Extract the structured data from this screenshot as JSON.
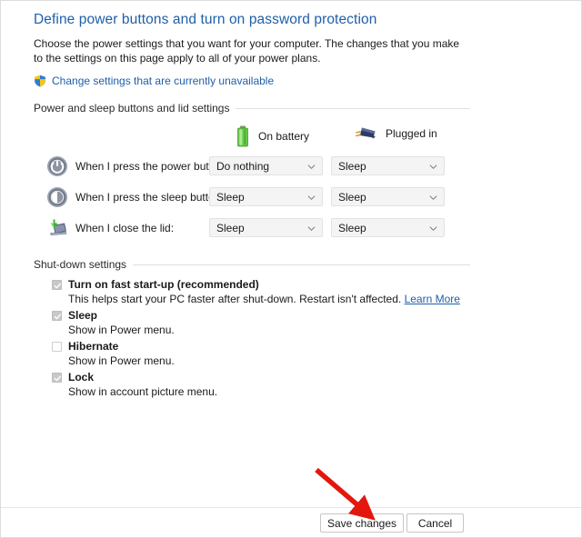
{
  "page": {
    "title": "Define power buttons and turn on password protection",
    "intro": "Choose the power settings that you want for your computer. The changes that you make to the settings on this page apply to all of your power plans.",
    "admin_link": "Change settings that are currently unavailable",
    "admin_link_icon": "uac-shield-icon"
  },
  "sections": {
    "power_buttons": {
      "heading": "Power and sleep buttons and lid settings",
      "columns": [
        {
          "label": "On battery",
          "icon": "battery-icon"
        },
        {
          "label": "Plugged in",
          "icon": "power-plug-icon"
        }
      ],
      "rows": [
        {
          "icon": "power-button-icon",
          "label": "When I press the power button:",
          "on_battery": "Do nothing",
          "plugged_in": "Sleep"
        },
        {
          "icon": "sleep-button-icon",
          "label": "When I press the sleep button:",
          "on_battery": "Sleep",
          "plugged_in": "Sleep"
        },
        {
          "icon": "laptop-lid-icon",
          "label": "When I close the lid:",
          "on_battery": "Sleep",
          "plugged_in": "Sleep"
        }
      ]
    },
    "shutdown": {
      "heading": "Shut-down settings",
      "options": [
        {
          "label": "Turn on fast start-up (recommended)",
          "checked": true,
          "description": "This helps start your PC faster after shut-down. Restart isn't affected.",
          "link": "Learn More"
        },
        {
          "label": "Sleep",
          "checked": true,
          "description": "Show in Power menu.",
          "link": ""
        },
        {
          "label": "Hibernate",
          "checked": false,
          "description": "Show in Power menu.",
          "link": ""
        },
        {
          "label": "Lock",
          "checked": true,
          "description": "Show in account picture menu.",
          "link": ""
        }
      ]
    }
  },
  "footer": {
    "save_label": "Save changes",
    "cancel_label": "Cancel"
  },
  "annotation": {
    "arrow_color": "#E3170D",
    "target": "Save changes"
  },
  "colors": {
    "title_blue": "#1F5FA9",
    "link_blue": "#1F5FA9",
    "battery_green": "#56C23A",
    "arrow_red": "#E3170D"
  }
}
